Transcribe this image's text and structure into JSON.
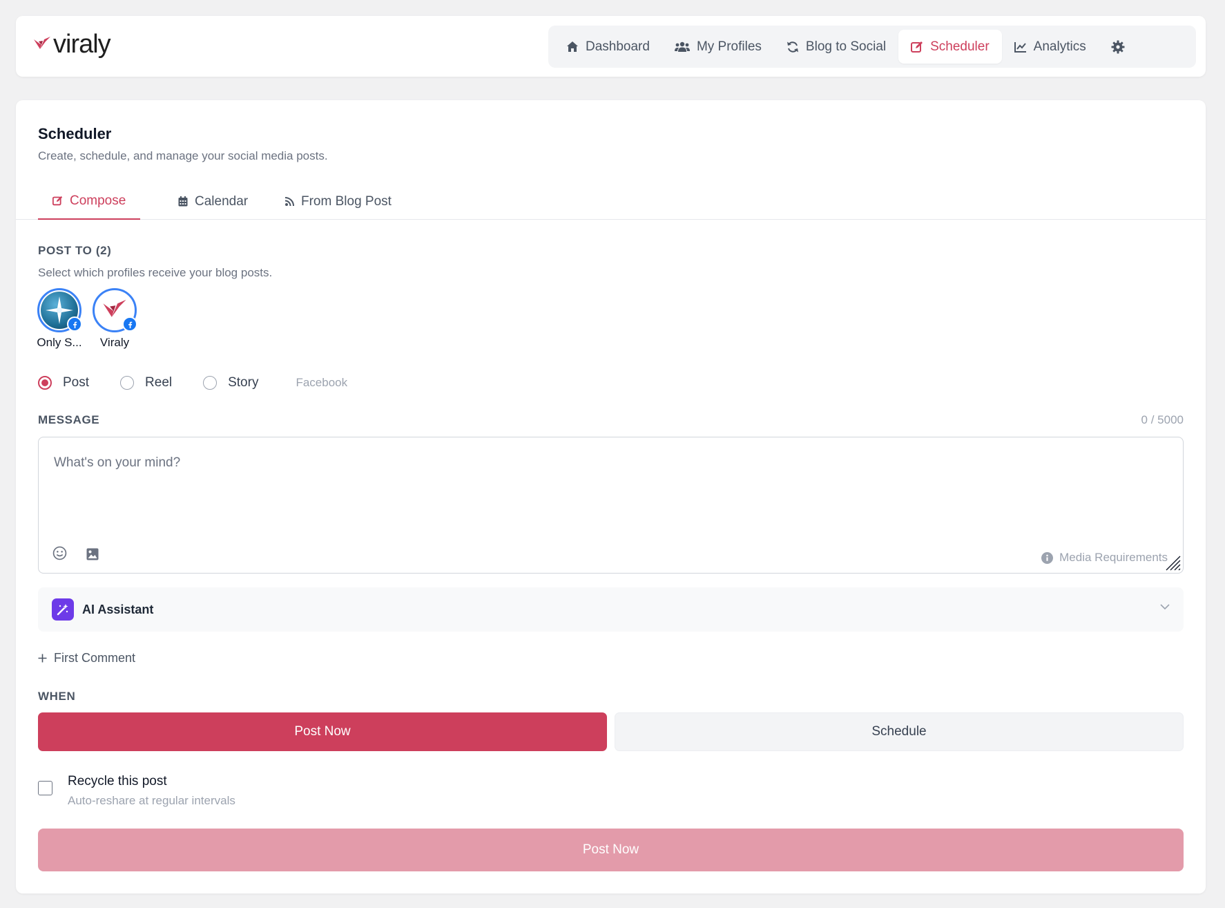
{
  "brand": {
    "name": "viraly",
    "accent": "#cd3f5c",
    "fb_blue": "#1877f2"
  },
  "nav": {
    "items": [
      {
        "label": "Dashboard",
        "icon": "home-icon"
      },
      {
        "label": "My Profiles",
        "icon": "users-icon"
      },
      {
        "label": "Blog to Social",
        "icon": "sync-icon"
      },
      {
        "label": "Scheduler",
        "icon": "edit-icon",
        "active": true
      },
      {
        "label": "Analytics",
        "icon": "chart-line-icon"
      }
    ],
    "settings_icon": "gear-icon"
  },
  "page": {
    "title": "Scheduler",
    "subtitle": "Create, schedule, and manage your social media posts."
  },
  "tabs": [
    {
      "label": "Compose",
      "icon": "edit-icon",
      "active": true
    },
    {
      "label": "Calendar",
      "icon": "calendar-icon"
    },
    {
      "label": "From Blog Post",
      "icon": "rss-icon"
    }
  ],
  "post_to": {
    "label": "POST TO (2)",
    "hint": "Select which profiles receive your blog posts.",
    "profiles": [
      {
        "name": "Only S...",
        "network": "facebook"
      },
      {
        "name": "Viraly",
        "network": "facebook"
      }
    ]
  },
  "post_type": {
    "options": [
      "Post",
      "Reel",
      "Story"
    ],
    "selected": "Post",
    "platform": "Facebook"
  },
  "message": {
    "label": "MESSAGE",
    "counter": "0 / 5000",
    "value": "",
    "placeholder": "What's on your mind?",
    "media_requirements": "Media Requirements"
  },
  "ai_assistant": {
    "label": "AI Assistant",
    "expanded": false
  },
  "first_comment": {
    "label": "First Comment"
  },
  "when": {
    "label": "WHEN",
    "options": [
      "Post Now",
      "Schedule"
    ],
    "selected": "Post Now"
  },
  "recycle": {
    "title": "Recycle this post",
    "subtitle": "Auto-reshare at regular intervals",
    "checked": false
  },
  "submit": {
    "label": "Post Now",
    "disabled": true
  }
}
